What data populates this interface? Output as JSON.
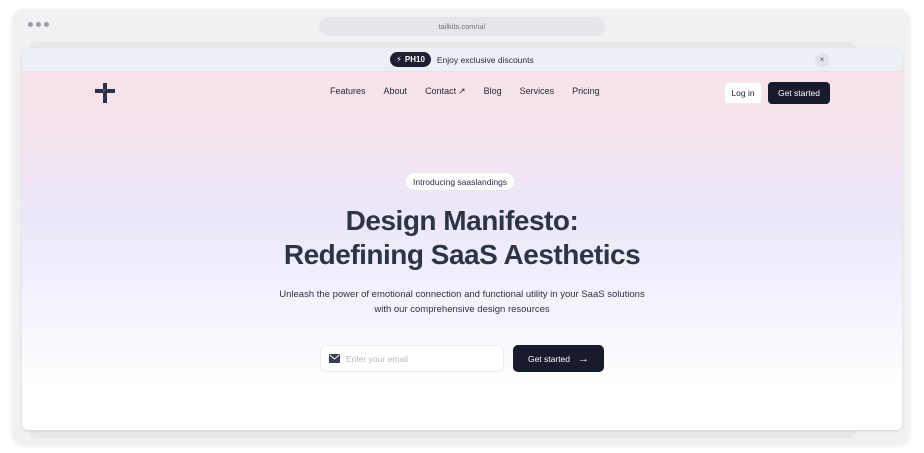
{
  "browser": {
    "url": "tailkits.com/ui/"
  },
  "promo": {
    "code": "PH10",
    "text": "Enjoy exclusive discounts",
    "close_icon": "×"
  },
  "header": {
    "nav": [
      {
        "label": "Features"
      },
      {
        "label": "About"
      },
      {
        "label": "Contact",
        "icon": "↗"
      },
      {
        "label": "Blog"
      },
      {
        "label": "Services"
      },
      {
        "label": "Pricing"
      }
    ],
    "login_label": "Log in",
    "get_started_label": "Get started"
  },
  "hero": {
    "badge": "Introducing saaslandings",
    "title_line1": "Design Manifesto:",
    "title_line2": "Redefining SaaS Aesthetics",
    "subtitle": "Unleash the power of emotional connection and functional utility in your SaaS solutions with our comprehensive design resources",
    "email_placeholder": "Enter your email",
    "cta_label": "Get started",
    "cta_icon": "→"
  },
  "colors": {
    "primary_dark": "#171b2c",
    "gradient_top": "#fbe2e6",
    "gradient_mid": "#ece8fa"
  }
}
